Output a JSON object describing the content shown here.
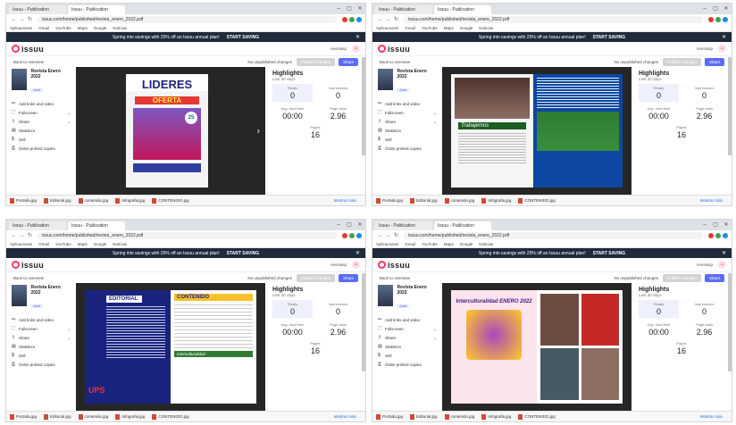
{
  "colors": {
    "accent": "#5c6bff",
    "promo_bg": "#1f2a3a",
    "brand": "#ff3366",
    "viewer_bg": "#262626"
  },
  "quadrants": [
    {
      "tabs": [
        "Issuu - Publication",
        "Issuu - Publication"
      ],
      "url": "issuu.com/home/published/revista_enero_2022.pdf",
      "bookmarks": [
        "Aplicaciones",
        "Gmail",
        "YouTube",
        "Maps",
        "Google",
        "Noticias"
      ],
      "promo": {
        "text": "Spring into savings with 25% off an Issuu annual plan!",
        "cta": "START SAVING"
      },
      "logo": "issuu",
      "account": "revistasp",
      "back": "Back to overview",
      "changes": "No unpublished changes",
      "publish": "Publish changes",
      "share": "Share",
      "doc": {
        "title": "Revista Enero 2022",
        "badge": "Draft"
      },
      "menu": [
        {
          "label": "Add links and video",
          "icon": "link-icon",
          "chev": false
        },
        {
          "label": "Fullscreen",
          "icon": "expand-icon",
          "chev": true
        },
        {
          "label": "Share",
          "icon": "share-icon",
          "chev": true
        },
        {
          "label": "Statistics",
          "icon": "chart-icon",
          "chev": false
        },
        {
          "label": "Sell",
          "icon": "dollar-icon",
          "chev": false
        },
        {
          "label": "Order printed copies",
          "icon": "print-icon",
          "chev": false
        }
      ],
      "highlights": {
        "title": "Highlights",
        "sub": "Last 30 days",
        "reads_label": "Reads",
        "reads": "0",
        "impressions_label": "Impressions",
        "impressions": "0",
        "avg_label": "Avg. read time",
        "avg": "00:00",
        "pps_label": "Page stats",
        "pps": "2.96",
        "pages_label": "Pages",
        "pages": "16"
      },
      "downloads": [
        "Portada.jpg",
        "Editorial.jpg",
        "contenido.jpg",
        "Infografia.jpg",
        "CONTENIDO.jpg"
      ],
      "show_all": "Mostrar todo",
      "page_theme": "cover"
    },
    {
      "tabs": [
        "Issuu - Publication",
        "Issuu - Publication"
      ],
      "url": "issuu.com/home/published/revista_enero_2022.pdf",
      "bookmarks": [
        "Aplicaciones",
        "Gmail",
        "YouTube",
        "Maps",
        "Google",
        "Noticias"
      ],
      "promo": {
        "text": "Spring into savings with 25% off an Issuu annual plan!",
        "cta": "START SAVING"
      },
      "logo": "issuu",
      "account": "revistasp",
      "back": "Back to overview",
      "changes": "No unpublished changes",
      "publish": "Publish changes",
      "share": "Share",
      "doc": {
        "title": "Revista Enero 2022",
        "badge": "Draft"
      },
      "menu": [
        {
          "label": "Add links and video",
          "icon": "link-icon",
          "chev": false
        },
        {
          "label": "Fullscreen",
          "icon": "expand-icon",
          "chev": true
        },
        {
          "label": "Share",
          "icon": "share-icon",
          "chev": true
        },
        {
          "label": "Statistics",
          "icon": "chart-icon",
          "chev": false
        },
        {
          "label": "Sell",
          "icon": "dollar-icon",
          "chev": false
        },
        {
          "label": "Order printed copies",
          "icon": "print-icon",
          "chev": false
        }
      ],
      "highlights": {
        "title": "Highlights",
        "sub": "Last 30 days",
        "reads_label": "Reads",
        "reads": "0",
        "impressions_label": "Impressions",
        "impressions": "0",
        "avg_label": "Avg. read time",
        "avg": "00:00",
        "pps_label": "Page stats",
        "pps": "2.96",
        "pages_label": "Pages",
        "pages": "16"
      },
      "downloads": [
        "Portada.jpg",
        "Editorial.jpg",
        "contenido.jpg",
        "Infografia.jpg",
        "CONTENIDO.jpg"
      ],
      "show_all": "Mostrar todo",
      "page_theme": "spread-a"
    },
    {
      "tabs": [
        "Issuu - Publication",
        "Issuu - Publication"
      ],
      "url": "issuu.com/home/published/revista_enero_2022.pdf",
      "bookmarks": [
        "Aplicaciones",
        "Gmail",
        "YouTube",
        "Maps",
        "Google",
        "Noticias"
      ],
      "promo": {
        "text": "Spring into savings with 25% off an Issuu annual plan!",
        "cta": "START SAVING"
      },
      "logo": "issuu",
      "account": "revistasp",
      "back": "Back to overview",
      "changes": "No unpublished changes",
      "publish": "Publish changes",
      "share": "Share",
      "doc": {
        "title": "Revista Enero 2022",
        "badge": "Draft"
      },
      "menu": [
        {
          "label": "Add links and video",
          "icon": "link-icon",
          "chev": false
        },
        {
          "label": "Fullscreen",
          "icon": "expand-icon",
          "chev": true
        },
        {
          "label": "Share",
          "icon": "share-icon",
          "chev": true
        },
        {
          "label": "Statistics",
          "icon": "chart-icon",
          "chev": false
        },
        {
          "label": "Sell",
          "icon": "dollar-icon",
          "chev": false
        },
        {
          "label": "Order printed copies",
          "icon": "print-icon",
          "chev": false
        }
      ],
      "highlights": {
        "title": "Highlights",
        "sub": "Last 30 days",
        "reads_label": "Reads",
        "reads": "0",
        "impressions_label": "Impressions",
        "impressions": "0",
        "avg_label": "Avg. read time",
        "avg": "00:00",
        "pps_label": "Page stats",
        "pps": "2.96",
        "pages_label": "Pages",
        "pages": "16"
      },
      "downloads": [
        "Portada.jpg",
        "Editorial.jpg",
        "contenido.jpg",
        "Infografia.jpg",
        "CONTENIDO.jpg"
      ],
      "show_all": "Mostrar todo",
      "page_theme": "spread-b"
    },
    {
      "tabs": [
        "Issuu - Publication",
        "Issuu - Publication"
      ],
      "url": "issuu.com/home/published/revista_enero_2022.pdf",
      "bookmarks": [
        "Aplicaciones",
        "Gmail",
        "YouTube",
        "Maps",
        "Google",
        "Noticias"
      ],
      "promo": {
        "text": "Spring into savings with 25% off an Issuu annual plan!",
        "cta": "START SAVING"
      },
      "logo": "issuu",
      "account": "revistasp",
      "back": "Back to overview",
      "changes": "No unpublished changes",
      "publish": "Publish changes",
      "share": "Share",
      "doc": {
        "title": "Revista Enero 2022",
        "badge": "Draft"
      },
      "menu": [
        {
          "label": "Add links and video",
          "icon": "link-icon",
          "chev": false
        },
        {
          "label": "Fullscreen",
          "icon": "expand-icon",
          "chev": true
        },
        {
          "label": "Share",
          "icon": "share-icon",
          "chev": true
        },
        {
          "label": "Statistics",
          "icon": "chart-icon",
          "chev": false
        },
        {
          "label": "Sell",
          "icon": "dollar-icon",
          "chev": false
        },
        {
          "label": "Order printed copies",
          "icon": "print-icon",
          "chev": false
        }
      ],
      "highlights": {
        "title": "Highlights",
        "sub": "Last 30 days",
        "reads_label": "Reads",
        "reads": "0",
        "impressions_label": "Impressions",
        "impressions": "0",
        "avg_label": "Avg. read time",
        "avg": "00:00",
        "pps_label": "Page stats",
        "pps": "2.96",
        "pages_label": "Pages",
        "pages": "16"
      },
      "downloads": [
        "Portada.jpg",
        "Editorial.jpg",
        "contenido.jpg",
        "Infografia.jpg",
        "CONTENIDO.jpg"
      ],
      "show_all": "Mostrar todo",
      "page_theme": "spread-c"
    }
  ],
  "cover": {
    "masthead": "LIDERES",
    "banner": "OFERTA",
    "badge": "25"
  },
  "spread_a": {
    "headline": "Trabajemos"
  },
  "spread_b": {
    "left_title": "EDITORIAL",
    "right_title": "CONTENIDO",
    "mascot": "UPS",
    "footer": "Interculturalidad"
  },
  "spread_c": {
    "headline": "Interculturalidad ENERO 2022"
  }
}
